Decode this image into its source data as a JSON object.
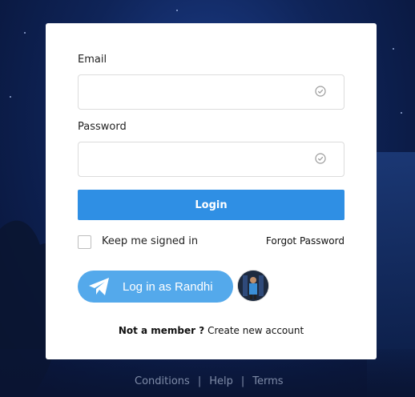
{
  "form": {
    "email_label": "Email",
    "email_value": "",
    "password_label": "Password",
    "password_value": "",
    "login_label": "Login",
    "keep_signed_in_label": "Keep me signed in",
    "forgot_password_label": "Forgot Password",
    "telegram_label": "Log in as Randhi",
    "not_member_label": "Not a member ?",
    "create_account_label": "Create new account"
  },
  "footer": {
    "links": [
      "Conditions",
      "Help",
      "Terms"
    ],
    "separator": "|"
  },
  "colors": {
    "login_button": "#2f8fe4",
    "telegram_button": "#54a9eb"
  },
  "icons": {
    "email_check": "check-circle-icon",
    "password_check": "check-circle-icon",
    "telegram": "telegram-plane-icon"
  }
}
